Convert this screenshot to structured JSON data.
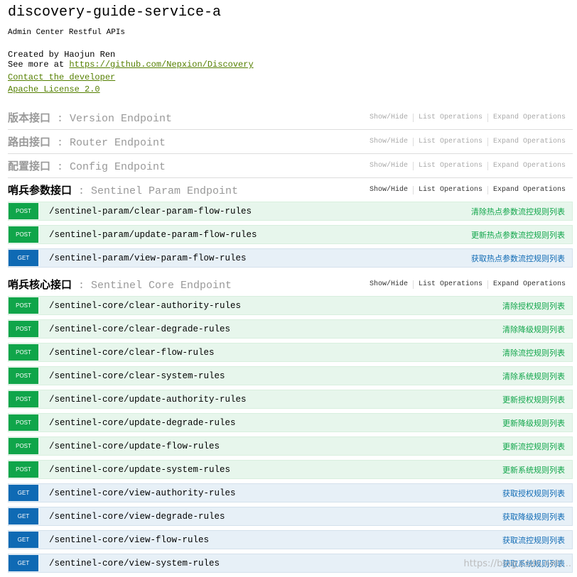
{
  "header": {
    "title": "discovery-guide-service-a",
    "description": "Admin Center Restful APIs",
    "created_by": "Created by Haojun Ren",
    "see_more_prefix": "See more at ",
    "see_more_link": "https://github.com/Nepxion/Discovery",
    "contact_link": "Contact the developer",
    "license_link": "Apache License 2.0"
  },
  "ops_labels": {
    "show_hide": "Show/Hide",
    "list_operations": "List Operations",
    "expand_operations": "Expand Operations"
  },
  "resources": [
    {
      "zh": "版本接口",
      "sep": " : ",
      "en": "Version Endpoint",
      "expanded": false,
      "operations": []
    },
    {
      "zh": "路由接口",
      "sep": " : ",
      "en": "Router Endpoint",
      "expanded": false,
      "operations": []
    },
    {
      "zh": "配置接口",
      "sep": " : ",
      "en": "Config Endpoint",
      "expanded": false,
      "operations": []
    },
    {
      "zh": "哨兵参数接口",
      "sep": " : ",
      "en": "Sentinel Param Endpoint",
      "expanded": true,
      "operations": [
        {
          "method": "POST",
          "path": "/sentinel-param/clear-param-flow-rules",
          "summary": "清除热点参数流控规则列表"
        },
        {
          "method": "POST",
          "path": "/sentinel-param/update-param-flow-rules",
          "summary": "更新热点参数流控规则列表"
        },
        {
          "method": "GET",
          "path": "/sentinel-param/view-param-flow-rules",
          "summary": "获取热点参数流控规则列表"
        }
      ]
    },
    {
      "zh": "哨兵核心接口",
      "sep": " : ",
      "en": "Sentinel Core Endpoint",
      "expanded": true,
      "operations": [
        {
          "method": "POST",
          "path": "/sentinel-core/clear-authority-rules",
          "summary": "清除授权规则列表"
        },
        {
          "method": "POST",
          "path": "/sentinel-core/clear-degrade-rules",
          "summary": "清除降级规则列表"
        },
        {
          "method": "POST",
          "path": "/sentinel-core/clear-flow-rules",
          "summary": "清除流控规则列表"
        },
        {
          "method": "POST",
          "path": "/sentinel-core/clear-system-rules",
          "summary": "清除系统规则列表"
        },
        {
          "method": "POST",
          "path": "/sentinel-core/update-authority-rules",
          "summary": "更新授权规则列表"
        },
        {
          "method": "POST",
          "path": "/sentinel-core/update-degrade-rules",
          "summary": "更新降级规则列表"
        },
        {
          "method": "POST",
          "path": "/sentinel-core/update-flow-rules",
          "summary": "更新流控规则列表"
        },
        {
          "method": "POST",
          "path": "/sentinel-core/update-system-rules",
          "summary": "更新系统规则列表"
        },
        {
          "method": "GET",
          "path": "/sentinel-core/view-authority-rules",
          "summary": "获取授权规则列表"
        },
        {
          "method": "GET",
          "path": "/sentinel-core/view-degrade-rules",
          "summary": "获取降级规则列表"
        },
        {
          "method": "GET",
          "path": "/sentinel-core/view-flow-rules",
          "summary": "获取流控规则列表"
        },
        {
          "method": "GET",
          "path": "/sentinel-core/view-system-rules",
          "summary": "获取系统规则列表"
        }
      ]
    }
  ],
  "watermark": "https://blog.csdn.net/..."
}
